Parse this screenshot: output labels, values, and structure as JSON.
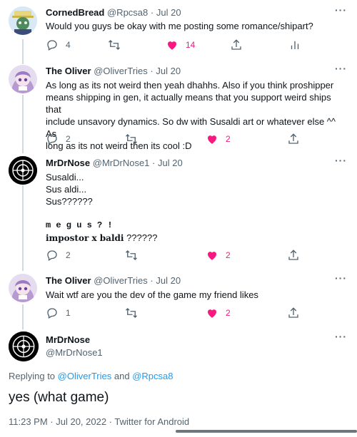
{
  "colors": {
    "accent": "#1d9bf0",
    "like": "#f91880",
    "muted": "#536471",
    "text": "#0f1419"
  },
  "tweets": [
    {
      "name": "CornedBread",
      "handle": "@Rpcsa8",
      "dot": "·",
      "time": "Jul 20",
      "lines": [
        "Would you guys be okay with me posting some romance/shipart?"
      ],
      "replies": "4",
      "likes": "14"
    },
    {
      "name": "The Oliver",
      "handle": "@OliverTries",
      "dot": "·",
      "time": "Jul 20",
      "lines": [
        "As long as its not weird then yeah dhahhs. Also if you think proshipper",
        "means shipping in gen, it actually means that you support weird ships that",
        "include unsavory dynamics. So dw with Susaldi art or whatever else ^^ As",
        "long as its not weird then its cool :D"
      ],
      "replies": "2",
      "likes": "2"
    },
    {
      "name": "MrDrNose",
      "handle": "@MrDrNose1",
      "dot": "·",
      "time": "Jul 20",
      "lines": [
        "Susaldi...",
        "Sus aldi...",
        "Sus??????"
      ],
      "styled_line1": "m e g u s ? !",
      "styled_line2_bold": "impostor x baldi",
      "styled_line2_rest": " ??????",
      "replies": "2",
      "likes": "2"
    },
    {
      "name": "The Oliver",
      "handle": "@OliverTries",
      "dot": "·",
      "time": "Jul 20",
      "lines": [
        "Wait wtf are you the dev of the game my friend likes"
      ],
      "replies": "1",
      "likes": "2"
    }
  ],
  "main_tweet": {
    "name": "MrDrNose",
    "handle": "@MrDrNose1",
    "replying_prefix": "Replying to",
    "replying_user1": "@OliverTries",
    "replying_and": "and",
    "replying_user2": "@Rpcsa8",
    "text": "yes (what game)",
    "meta": "11:23 PM · Jul 20, 2022 · Twitter for Android"
  },
  "icons": [
    "reply-icon",
    "retweet-icon",
    "like-icon",
    "share-icon",
    "analytics-icon",
    "more-icon"
  ]
}
